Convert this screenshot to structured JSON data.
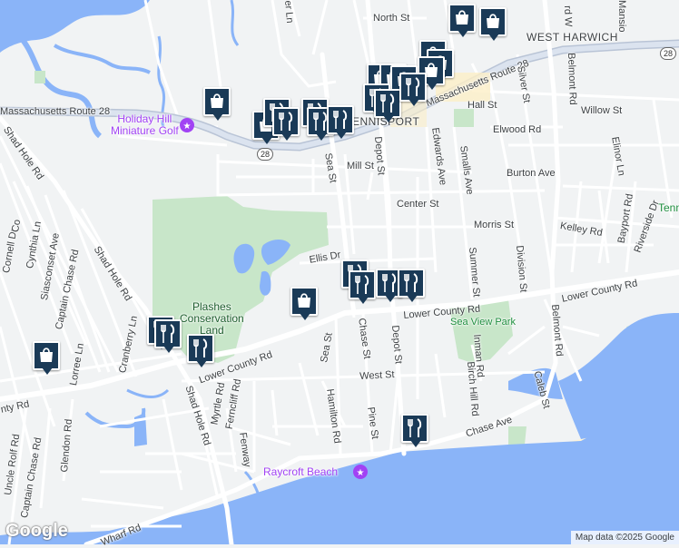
{
  "map": {
    "streets": [
      "North St",
      "Massachusetts Route 28",
      "Route 28",
      "West Harwich",
      "Mill St",
      "Burton Ave",
      "Center St",
      "Morris St",
      "Kelley Rd",
      "Bayport Rd",
      "Riverside Dr",
      "Ellis Dr",
      "Lower County Rd",
      "Sea St",
      "Depot St",
      "Chase St",
      "West St",
      "Pine St",
      "Hamilton Rd",
      "Fenway",
      "Ferncliff Rd",
      "Myrtle Rd",
      "Shad Hole Rd",
      "Cranberry Ln",
      "Glendon Rd",
      "Lorree Ln",
      "Captain Chase Rd",
      "Uncle Rolf Rd",
      "Cynthia Ln",
      "Siasconset Ave",
      "Cornell Dr",
      "Hall St",
      "Willow St",
      "Elwood Rd",
      "Edwards Ave",
      "Smalls Ave",
      "Summer St",
      "Inman Rd",
      "Birch Hill Rd",
      "Division St",
      "Silver St",
      "Belmont Rd",
      "Caleb St",
      "Elinor Ln",
      "Chase Ave",
      "Wharf Rd",
      "Mansion"
    ],
    "places": {
      "holiday_hill": "Holiday Hill\nMiniature Golf",
      "plashes": "Plashes\nConservation\nLand",
      "sea_view_park": "Sea View Park",
      "raycroft_beach": "Raycroft Beach",
      "dennisport": "ENNISPORT",
      "tennis": "Tenn",
      "route_shield": "28"
    },
    "labels": {
      "north_st": "North St",
      "mass_route_28_right": "Massachusetts Route 28",
      "mass_route_28_left": "Massachusetts Route 28",
      "west_harwich": "WEST HARWICH",
      "mill_st": "Mill St",
      "burton_ave": "Burton Ave",
      "center_st": "Center St",
      "morris_st": "Morris St",
      "kelley_rd": "Kelley Rd",
      "bayport_rd": "Bayport Rd",
      "riverside_dr": "Riverside Dr",
      "ellis_dr": "Ellis Dr",
      "lower_county_rd_mid": "Lower County Rd",
      "lower_county_rd_right": "Lower County Rd",
      "lower_county_rd_left": "Lower County Rd",
      "county_rd_edge": "nty Rd",
      "sea_st_upper": "Sea St",
      "sea_st_lower": "Sea St",
      "depot_st_upper": "Depot St",
      "depot_st_lower": "Depot St",
      "chase_st": "Chase St",
      "west_st": "West St",
      "pine_st": "Pine St",
      "hamilton_rd": "Hamilton Rd",
      "fenway": "Fenway",
      "ferncliff_rd": "Ferncliff Rd",
      "myrtle_rd": "Myrtle Rd",
      "shad_hole_rd_upper": "Shad Hole Rd",
      "shad_hole_rd_mid": "Shad Hole Rd",
      "shad_hole_rd_lower": "Shad Hole Rd",
      "cranberry_ln": "Cranberry Ln",
      "glendon_rd": "Glendon Rd",
      "lorree_ln": "Lorree Ln",
      "captain_chase_rd_upper": "Captain Chase Rd",
      "captain_chase_rd_lower": "Captain Chase Rd",
      "uncle_rolf_rd": "Uncle Rolf Rd",
      "cynthia_ln": "Cynthia Ln",
      "siasconset_ave": "Siasconset Ave",
      "cornell_dr": "Cornell Dr",
      "hall_st": "Hall St",
      "willow_st": "Willow St",
      "elwood_rd": "Elwood Rd",
      "edwards_ave": "Edwards Ave",
      "smalls_ave": "Smalls Ave",
      "summer_st": "Summer St",
      "inman_rd": "Inman Rd",
      "birch_hill_rd": "Birch Hill Rd",
      "division_st": "Division St",
      "silver_st": "Silver St",
      "belmont_rd": "Belmont Rd",
      "caleb_st": "Caleb St",
      "elinor_ln": "Elinor Ln",
      "chase_ave": "Chase Ave",
      "wharf_rd": "Wharf Rd",
      "mansion": "Mansio",
      "er_ln": "er Ln",
      "cornell_partial": "Co",
      "rd_w": "rd W",
      "dep_partial": "n St"
    },
    "markers": [
      {
        "type": "shopping",
        "icon": "shopping-bag-icon"
      },
      {
        "type": "shopping",
        "icon": "shopping-bag-icon"
      },
      {
        "type": "shopping",
        "icon": "shopping-bag-icon"
      },
      {
        "type": "shopping",
        "icon": "shopping-bag-icon"
      },
      {
        "type": "shopping",
        "icon": "shopping-bag-icon"
      },
      {
        "type": "restaurant",
        "icon": "fork-knife-icon"
      }
    ],
    "attribution": "Map data ©2025 Google",
    "logo": "Google",
    "colors": {
      "water": "#8ab4f8",
      "land": "#f1f3f4",
      "park": "#c8e6c9",
      "road": "#ffffff",
      "major_road": "#c5cfe0",
      "marker": "#1a3a57",
      "sand": "#fdf3d8"
    }
  }
}
